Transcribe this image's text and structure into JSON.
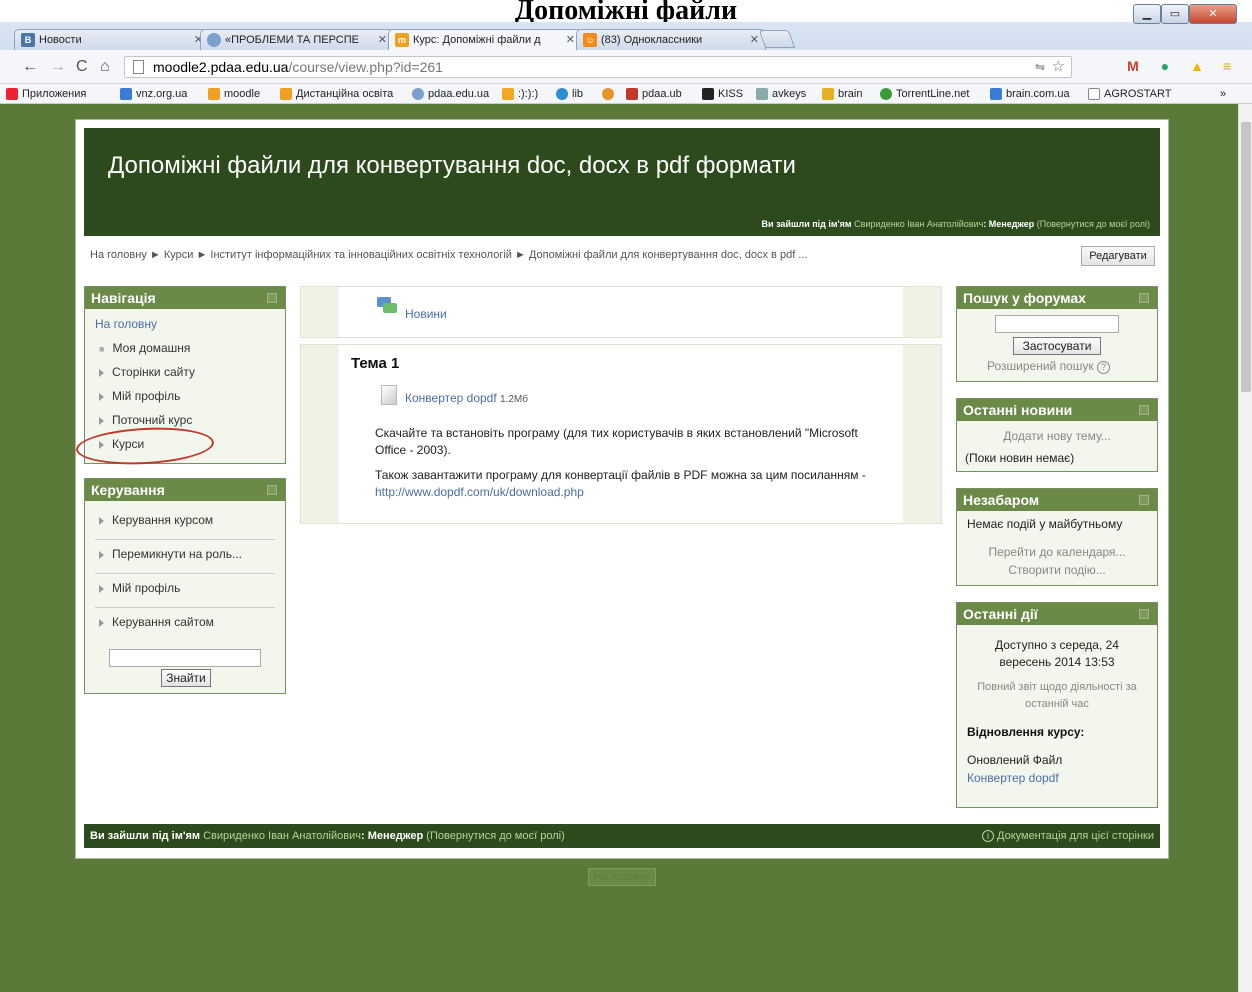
{
  "document_title": "Допоміжні файли",
  "browser": {
    "tabs": [
      {
        "icon": "В",
        "label": "Новости"
      },
      {
        "icon": "",
        "label": "«ПРОБЛЕМИ ТА ПЕРСПЕ"
      },
      {
        "icon": "",
        "label": "Курс: Допоміжні файли д"
      },
      {
        "icon": "",
        "label": "(83) Одноклассники"
      }
    ],
    "url_host": "moodle2.pdaa.edu.ua",
    "url_path": "/course/view.php?id=261",
    "bookmarks": [
      "Приложения",
      "vnz.org.ua",
      "moodle",
      "Дистанційна освіта",
      "pdaa.edu.ua",
      ":):):)",
      "lib",
      "",
      "pdaa.ub",
      "KISS",
      "avkeys",
      "brain",
      "TorrentLine.net",
      "brain.com.ua",
      "AGROSTART"
    ],
    "overflow": "»",
    "colors": {
      "page_bg": "#5b7a3a",
      "header_bg": "#2d4a1c",
      "block_header": "#6b8a48",
      "link": "#4a6ea8"
    }
  },
  "course": {
    "title": "Допоміжні файли для конвертування doc, docx в pdf формати",
    "logged_prefix": "Ви зайшли під ім'ям",
    "user_name": "Свириденко Іван Анатолійович",
    "role_sep": ":",
    "role": "Менеджер",
    "return_role": "(Повернутися до моєї ролі)",
    "breadcrumb": "На головну ► Курси ► Інститут інформаційних та інноваційних освітніх технологій ► Допоміжні файли для конвертування doc, docx в pdf ...",
    "edit_button": "Редагувати"
  },
  "navigation": {
    "title": "Навігація",
    "home": "На головну",
    "items": [
      "Моя домашня",
      "Сторінки сайту",
      "Мій профіль",
      "Поточний курс",
      "Курси"
    ]
  },
  "admin": {
    "title": "Керування",
    "items": [
      "Керування курсом",
      "Перемикнути на роль...",
      "Мій профіль",
      "Керування сайтом"
    ],
    "search_button": "Знайти"
  },
  "main": {
    "news_label": "Новини",
    "topic_title": "Тема 1",
    "file_name": "Конвертер dopdf",
    "file_size": "1.2Мб",
    "para1": "Скачайте та встановіть програму (для тих користувачів в яких встановлений \"Microsoft Office - 2003).",
    "para2_text": "Також завантажити програму для конвертації файлів в PDF можна за цим посиланням - ",
    "para2_link": "http://www.dopdf.com/uk/download.php"
  },
  "forum_search": {
    "title": "Пошук у форумах",
    "apply": "Застосувати",
    "advanced": "Розширений пошук"
  },
  "latest_news": {
    "title": "Останні новини",
    "add": "Додати нову тему...",
    "empty": "(Поки новин немає)"
  },
  "upcoming": {
    "title": "Незабаром",
    "none": "Немає подій у майбутньому",
    "goto": "Перейти до календаря...",
    "create": "Створити подію..."
  },
  "recent": {
    "title": "Останні дії",
    "since": "Доступно з середа, 24 вересень 2014 13:53",
    "full_report": "Повний звіт щодо діяльності за останній час",
    "restore_title": "Відновлення курсу:",
    "updated": "Оновлений Файл",
    "file": "Конвертер dopdf"
  },
  "footer": {
    "docs": "Документація для цієї сторінки",
    "home_button": "На головну"
  }
}
